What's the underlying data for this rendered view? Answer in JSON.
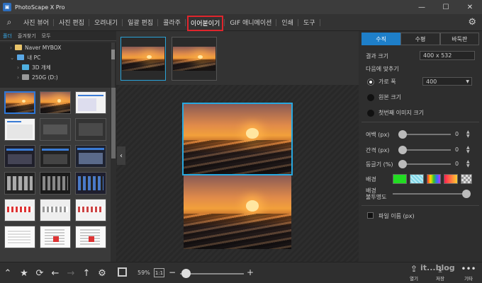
{
  "window": {
    "title": "PhotoScape X Pro",
    "minimize": "—",
    "maximize": "☐",
    "close": "✕"
  },
  "menu": {
    "tabs": [
      "사진 뷰어",
      "사진 편집",
      "오려내기",
      "일괄 편집",
      "콜라주",
      "이어붙이기",
      "GIF 애니메이션",
      "인쇄",
      "도구"
    ],
    "active": "이어붙이기"
  },
  "left": {
    "tabs": [
      "폴더",
      "즐겨찾기",
      "모두"
    ],
    "tree": [
      "Naver MYBOX",
      "내 PC",
      "3D 개체",
      "250G (D:)"
    ]
  },
  "strip": {
    "count": 2
  },
  "right": {
    "tabs": [
      "수직",
      "수평",
      "바둑판"
    ],
    "result_size_label": "결과 크기",
    "result_size_value": "400 x 532",
    "fit_label": "다음에 맞추기",
    "opt_width": "가로 폭",
    "opt_width_value": "400",
    "opt_original": "원본 크기",
    "opt_first": "첫번째 이미지 크기",
    "margin_label": "여백 (px)",
    "margin_value": "0",
    "spacing_label": "간격 (px)",
    "spacing_value": "0",
    "round_label": "둥글기 (%)",
    "round_value": "0",
    "bg_label": "배경",
    "bg_opacity_label": "배경\n불투명도",
    "bg_opacity_value": 1.0,
    "filename_label": "파일 이름 (px)"
  },
  "bottom": {
    "zoom": "59%",
    "one_to_one": "1:1",
    "open_label": "열기",
    "save_label": "저장",
    "more_label": "기타",
    "watermark": "it...blog"
  },
  "colors": {
    "accent": "#1e7fc9",
    "selection": "#27a8e0",
    "highlight": "#e0252c"
  }
}
